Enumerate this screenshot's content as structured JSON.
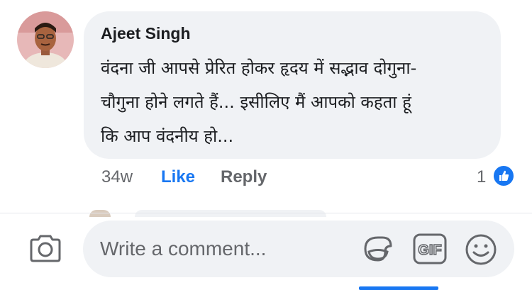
{
  "comment": {
    "author": "Ajeet Singh",
    "text": "वंदना जी आपसे प्रेरित होकर हृदय में सद्भाव दोगुना-\nचौगुना होने लगते हैं... इसीलिए मैं आपको कहता हूं\nकि आप वंदनीय हो...",
    "time": "34w",
    "like_label": "Like",
    "reply_label": "Reply",
    "reaction_count": "1",
    "reaction_icon": "like-thumb-icon"
  },
  "composer": {
    "placeholder": "Write a comment...",
    "gif_label": "GIF",
    "icons": [
      "camera-icon",
      "sticker-icon",
      "gif-icon",
      "emoji-icon"
    ]
  },
  "colors": {
    "accent": "#1877f2",
    "bubble": "#f0f2f5",
    "secondary_text": "#65676b",
    "primary_text": "#1c1e21"
  }
}
